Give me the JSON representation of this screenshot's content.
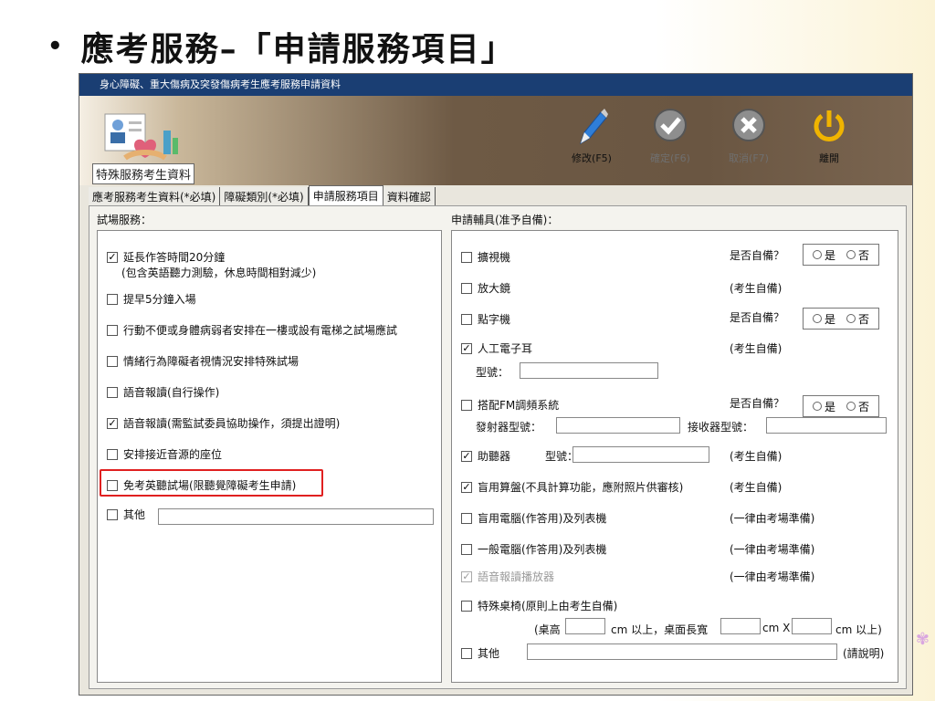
{
  "slide": {
    "bullet": "•",
    "title": "應考服務–「申請服務項目」"
  },
  "window": {
    "title": "身心障礙、重大傷病及突發傷病考生應考服務申請資料"
  },
  "toolbar": {
    "logo_label": "特殊服務考生資料",
    "modify": "修改(F5)",
    "confirm": "確定(F6)",
    "cancel": "取消(F7)",
    "leave": "離開"
  },
  "tabs": [
    "應考服務考生資料(*必填)",
    "障礙類別(*必填)",
    "申請服務項目",
    "資料確認"
  ],
  "left": {
    "label": "試場服務：",
    "items": [
      {
        "label": "延長作答時間20分鐘",
        "checked": true
      },
      {
        "label": "提早5分鐘入場",
        "checked": false
      },
      {
        "label": "行動不便或身體病弱者安排在一樓或設有電梯之試場應試",
        "checked": false
      },
      {
        "label": "情緒行為障礙者視情況安排特殊試場",
        "checked": false
      },
      {
        "label": "語音報讀(自行操作)",
        "checked": false
      },
      {
        "label": "語音報讀(需監試委員協助操作，須提出證明)",
        "checked": true
      },
      {
        "label": "安排接近音源的座位",
        "checked": false
      },
      {
        "label": "免考英聽試場(限聽覺障礙考生申請)",
        "checked": false
      },
      {
        "label": "其他",
        "checked": false
      }
    ],
    "sub_note": "(包含英語聽力測驗，休息時間相對減少)"
  },
  "right": {
    "label": "申請輔具(准予自備)：",
    "items": [
      {
        "label": "擴視機",
        "checked": false,
        "note": "是否自備？"
      },
      {
        "label": "放大鏡",
        "checked": false,
        "note": "(考生自備)"
      },
      {
        "label": "點字機",
        "checked": false,
        "note": "是否自備？"
      },
      {
        "label": "人工電子耳",
        "checked": true,
        "note": "(考生自備)"
      },
      {
        "label": "搭配FM調頻系統",
        "checked": false,
        "note": "是否自備？"
      },
      {
        "label": "助聽器",
        "checked": true,
        "note": "(考生自備)"
      },
      {
        "label": "盲用算盤(不具計算功能，應附照片供審核)",
        "checked": true,
        "note": "(考生自備)"
      },
      {
        "label": "盲用電腦(作答用)及列表機",
        "checked": false,
        "note": "(一律由考場準備)"
      },
      {
        "label": "一般電腦(作答用)及列表機",
        "checked": false,
        "note": "(一律由考場準備)"
      },
      {
        "label": "語音報讀播放器",
        "checked": true,
        "disabled": true,
        "note": "(一律由考場準備)"
      },
      {
        "label": "特殊桌椅(原則上由考生自備)",
        "checked": false,
        "note": ""
      },
      {
        "label": "其他",
        "checked": false,
        "note": "(請說明)"
      }
    ],
    "radio_yes": "是",
    "radio_no": "否",
    "model_label": "型號：",
    "transmitter_label": "發射器型號：",
    "receiver_label": "接收器型號：",
    "hearing_model_label": "型號：",
    "desk_open": "(桌高",
    "desk_mid1": "cm 以上，桌面長寬",
    "desk_mid2": "cm X",
    "desk_end": "cm 以上)"
  }
}
